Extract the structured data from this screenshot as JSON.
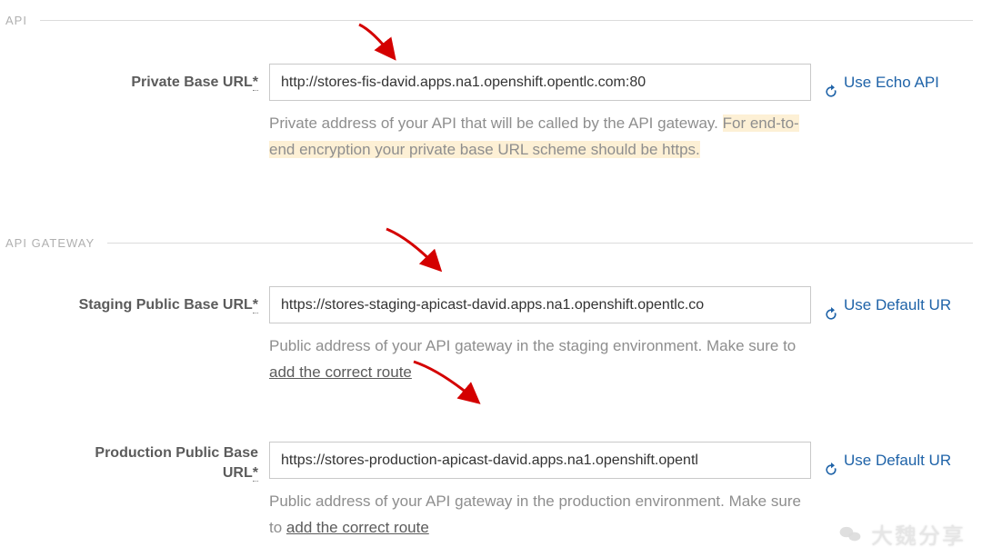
{
  "sections": {
    "api": {
      "title": "API"
    },
    "gateway": {
      "title": "API GATEWAY"
    }
  },
  "fields": {
    "private": {
      "label": "Private Base URL",
      "req": "*",
      "value": "http://stores-fis-david.apps.na1.openshift.opentlc.com:80",
      "aux_label": "Use Echo API",
      "help_pre": "Private address of your API that will be called by the API gateway. ",
      "help_hl": "For end-to-end encryption your private base URL scheme should be https.",
      "help_post": ""
    },
    "staging": {
      "label": "Staging Public Base URL",
      "req": "*",
      "value": "https://stores-staging-apicast-david.apps.na1.openshift.opentlc.co",
      "aux_label": "Use Default UR",
      "help_pre": "Public address of your API gateway in the staging environment. Make sure to ",
      "help_link": "add the correct route"
    },
    "production": {
      "label_1": "Production Public Base",
      "label_2": "URL",
      "req": "*",
      "value": "https://stores-production-apicast-david.apps.na1.openshift.opentl",
      "aux_label": "Use Default UR",
      "help_pre": "Public address of your API gateway in the production environment. Make sure to ",
      "help_link": "add the correct route"
    }
  },
  "watermark": {
    "text": "大魏分享"
  }
}
